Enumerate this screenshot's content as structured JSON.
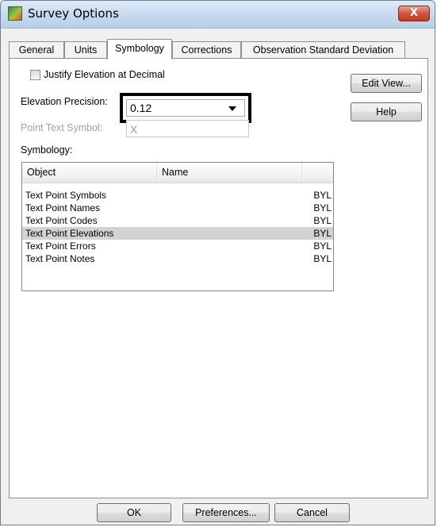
{
  "window": {
    "title": "Survey Options",
    "close_label": "X"
  },
  "tabs": [
    {
      "label": "General"
    },
    {
      "label": "Units"
    },
    {
      "label": "Symbology"
    },
    {
      "label": "Corrections"
    },
    {
      "label": "Observation Standard Deviation"
    }
  ],
  "symbology_tab": {
    "justify_label": "Justify Elevation at Decimal",
    "justify_checked": false,
    "elevation_precision_label": "Elevation Precision:",
    "elevation_precision_value": "0.12",
    "point_text_symbol_label": "Point Text Symbol:",
    "point_text_symbol_value": "X",
    "symbology_label": "Symbology:",
    "edit_view_label": "Edit View...",
    "help_label": "Help",
    "list": {
      "columns": [
        "Object",
        "Name",
        ""
      ],
      "rows": [
        {
          "object": "Text Point Symbols",
          "name": "",
          "symbology": "BYL",
          "selected": false
        },
        {
          "object": "Text Point Names",
          "name": "",
          "symbology": "BYL",
          "selected": false
        },
        {
          "object": "Text Point Codes",
          "name": "",
          "symbology": "BYL",
          "selected": false
        },
        {
          "object": "Text Point Elevations",
          "name": "",
          "symbology": "BYL",
          "selected": true
        },
        {
          "object": "Text Point Errors",
          "name": "",
          "symbology": "BYL",
          "selected": false
        },
        {
          "object": "Text Point Notes",
          "name": "",
          "symbology": "BYL",
          "selected": false
        }
      ]
    }
  },
  "footer": {
    "ok_label": "OK",
    "preferences_label": "Preferences...",
    "cancel_label": "Cancel"
  }
}
